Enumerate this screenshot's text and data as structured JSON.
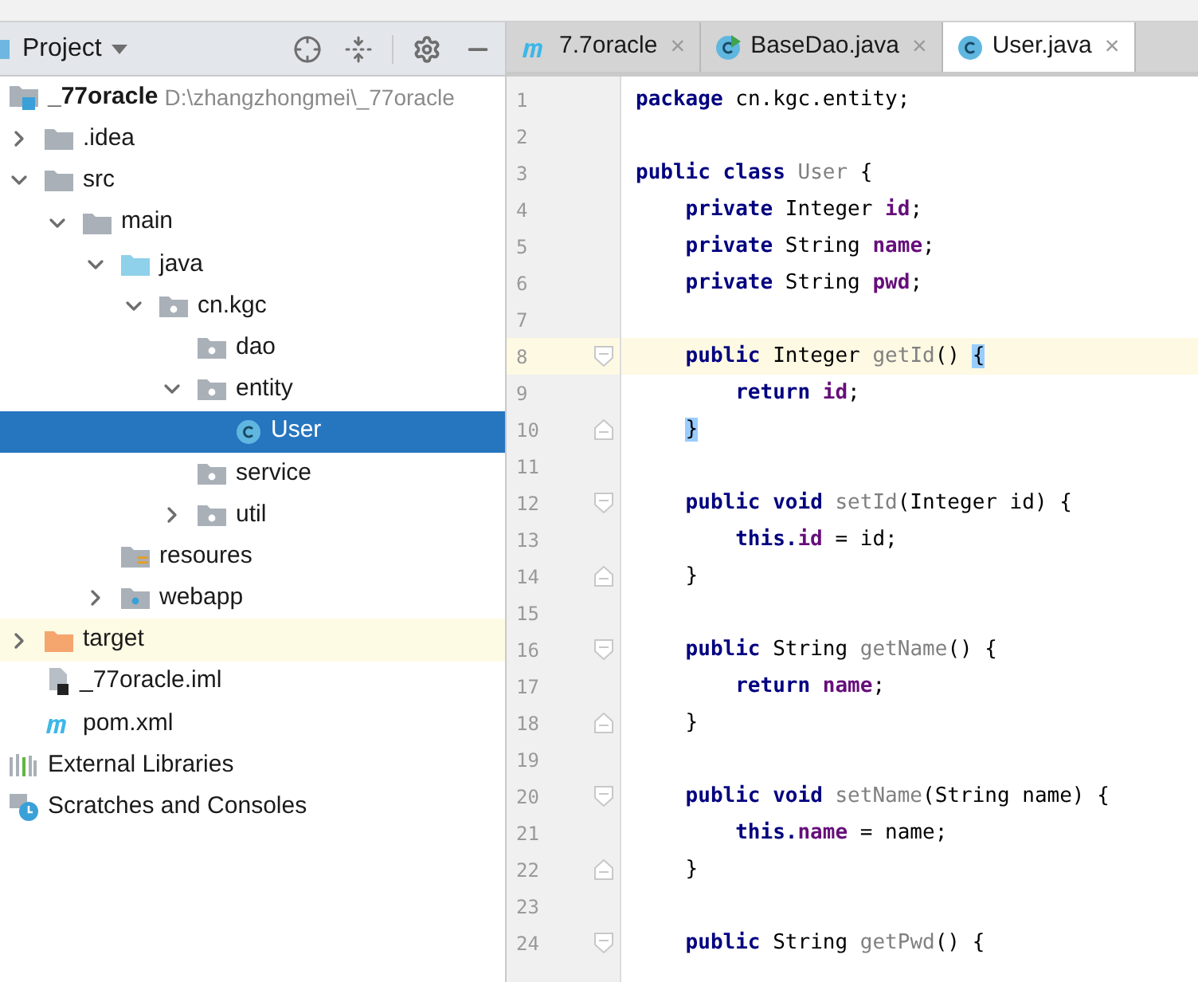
{
  "project_panel": {
    "title": "Project",
    "tree": [
      {
        "kind": "module",
        "name": "_77oracle",
        "path": "D:\\zhangzhongmei\\_77oracle",
        "selected": false,
        "highlighted": false,
        "children": [
          {
            "kind": "folder",
            "name": ".idea",
            "expanded": false,
            "selected": false,
            "highlighted": false
          },
          {
            "kind": "folder",
            "name": "src",
            "expanded": true,
            "selected": false,
            "highlighted": false,
            "children": [
              {
                "kind": "folder",
                "name": "main",
                "expanded": true,
                "selected": false,
                "highlighted": false,
                "children": [
                  {
                    "kind": "source",
                    "name": "java",
                    "expanded": true,
                    "selected": false,
                    "highlighted": false,
                    "children": [
                      {
                        "kind": "package",
                        "name": "cn.kgc",
                        "expanded": true,
                        "selected": false,
                        "highlighted": false,
                        "children": [
                          {
                            "kind": "package",
                            "name": "dao",
                            "selected": false,
                            "highlighted": false
                          },
                          {
                            "kind": "package",
                            "name": "entity",
                            "expanded": true,
                            "selected": false,
                            "highlighted": false,
                            "children": [
                              {
                                "kind": "class",
                                "name": "User",
                                "selected": true,
                                "highlighted": false
                              }
                            ]
                          },
                          {
                            "kind": "package",
                            "name": "service",
                            "selected": false,
                            "highlighted": false
                          },
                          {
                            "kind": "package",
                            "name": "util",
                            "expanded": false,
                            "selected": false,
                            "highlighted": false
                          }
                        ]
                      }
                    ]
                  },
                  {
                    "kind": "resources",
                    "name": "resoures",
                    "selected": false,
                    "highlighted": false
                  },
                  {
                    "kind": "web",
                    "name": "webapp",
                    "expanded": false,
                    "selected": false,
                    "highlighted": false
                  }
                ]
              }
            ]
          },
          {
            "kind": "excluded",
            "name": "target",
            "expanded": false,
            "selected": false,
            "highlighted": true
          },
          {
            "kind": "iml",
            "name": "_77oracle.iml",
            "selected": false,
            "highlighted": false
          },
          {
            "kind": "maven",
            "name": "pom.xml",
            "selected": false,
            "highlighted": false
          }
        ]
      },
      {
        "kind": "libraries",
        "name": "External Libraries",
        "selected": false,
        "highlighted": false
      },
      {
        "kind": "scratches",
        "name": "Scratches and Consoles",
        "selected": false,
        "highlighted": false
      }
    ]
  },
  "tabs": [
    {
      "kind": "maven",
      "label": "7.7oracle",
      "close": "×",
      "selected": false
    },
    {
      "kind": "runnable",
      "label": "BaseDao.java",
      "close": "×",
      "selected": false
    },
    {
      "kind": "class",
      "label": "User.java",
      "close": "×",
      "selected": true
    }
  ],
  "code": [
    {
      "number": "1",
      "kind": "line",
      "current": false,
      "tokens": [
        {
          "kind": "keyword",
          "text": "package"
        },
        {
          "kind": "plain",
          "text": " cn.kgc.entity;"
        }
      ]
    },
    {
      "number": "2",
      "kind": "line",
      "current": false
    },
    {
      "number": "3",
      "kind": "line",
      "current": false,
      "tokens": [
        {
          "kind": "keyword",
          "text": "public class"
        },
        {
          "kind": "unused",
          "text": " User"
        },
        {
          "kind": "plain",
          "text": " {"
        }
      ],
      "children": [
        {
          "number": "4",
          "kind": "line",
          "current": false,
          "tokens": [
            {
              "kind": "keyword",
              "text": "private"
            },
            {
              "kind": "plain",
              "text": " Integer "
            },
            {
              "kind": "field",
              "text": "id"
            },
            {
              "kind": "plain",
              "text": ";"
            }
          ]
        },
        {
          "number": "5",
          "kind": "line",
          "current": false,
          "tokens": [
            {
              "kind": "keyword",
              "text": "private"
            },
            {
              "kind": "plain",
              "text": " String "
            },
            {
              "kind": "field",
              "text": "name"
            },
            {
              "kind": "plain",
              "text": ";"
            }
          ]
        },
        {
          "number": "6",
          "kind": "line",
          "current": false,
          "tokens": [
            {
              "kind": "keyword",
              "text": "private"
            },
            {
              "kind": "plain",
              "text": " String "
            },
            {
              "kind": "field",
              "text": "pwd"
            },
            {
              "kind": "plain",
              "text": ";"
            }
          ]
        },
        {
          "number": "7",
          "kind": "line",
          "current": false
        },
        {
          "number": "8",
          "kind": "opener",
          "current": true,
          "tokens": [
            {
              "kind": "keyword",
              "text": "public"
            },
            {
              "kind": "plain",
              "text": " Integer "
            },
            {
              "kind": "unused",
              "text": "getId"
            },
            {
              "kind": "plain",
              "text": "() "
            },
            {
              "kind": "match",
              "text": "{"
            }
          ],
          "children": [
            {
              "number": "9",
              "kind": "line",
              "current": false,
              "tokens": [
                {
                  "kind": "keyword",
                  "text": "return"
                },
                {
                  "kind": "field",
                  "text": " id"
                },
                {
                  "kind": "plain",
                  "text": ";"
                }
              ]
            }
          ]
        },
        {
          "number": "10",
          "kind": "closer",
          "current": false,
          "tokens": [
            {
              "kind": "match",
              "text": "}"
            }
          ]
        },
        {
          "number": "11",
          "kind": "line",
          "current": false
        },
        {
          "number": "12",
          "kind": "opener",
          "current": false,
          "tokens": [
            {
              "kind": "keyword",
              "text": "public void"
            },
            {
              "kind": "unused",
              "text": " setId"
            },
            {
              "kind": "plain",
              "text": "(Integer id) {"
            }
          ],
          "children": [
            {
              "number": "13",
              "kind": "line",
              "current": false,
              "tokens": [
                {
                  "kind": "keyword",
                  "text": "this."
                },
                {
                  "kind": "field",
                  "text": "id"
                },
                {
                  "kind": "plain",
                  "text": " = id;"
                }
              ]
            }
          ]
        },
        {
          "number": "14",
          "kind": "closer",
          "current": false,
          "tokens": [
            {
              "kind": "plain",
              "text": "}"
            }
          ]
        },
        {
          "number": "15",
          "kind": "line",
          "current": false
        },
        {
          "number": "16",
          "kind": "opener",
          "current": false,
          "tokens": [
            {
              "kind": "keyword",
              "text": "public"
            },
            {
              "kind": "plain",
              "text": " String "
            },
            {
              "kind": "unused",
              "text": "getName"
            },
            {
              "kind": "plain",
              "text": "() {"
            }
          ],
          "children": [
            {
              "number": "17",
              "kind": "line",
              "current": false,
              "tokens": [
                {
                  "kind": "keyword",
                  "text": "return"
                },
                {
                  "kind": "field",
                  "text": " name"
                },
                {
                  "kind": "plain",
                  "text": ";"
                }
              ]
            }
          ]
        },
        {
          "number": "18",
          "kind": "closer",
          "current": false,
          "tokens": [
            {
              "kind": "plain",
              "text": "}"
            }
          ]
        },
        {
          "number": "19",
          "kind": "line",
          "current": false
        },
        {
          "number": "20",
          "kind": "opener",
          "current": false,
          "tokens": [
            {
              "kind": "keyword",
              "text": "public void"
            },
            {
              "kind": "unused",
              "text": " setName"
            },
            {
              "kind": "plain",
              "text": "(String name) {"
            }
          ],
          "children": [
            {
              "number": "21",
              "kind": "line",
              "current": false,
              "tokens": [
                {
                  "kind": "keyword",
                  "text": "this."
                },
                {
                  "kind": "field",
                  "text": "name"
                },
                {
                  "kind": "plain",
                  "text": " = name;"
                }
              ]
            }
          ]
        },
        {
          "number": "22",
          "kind": "closer",
          "current": false,
          "tokens": [
            {
              "kind": "plain",
              "text": "}"
            }
          ]
        },
        {
          "number": "23",
          "kind": "line",
          "current": false
        },
        {
          "number": "24",
          "kind": "opener",
          "current": false,
          "tokens": [
            {
              "kind": "keyword",
              "text": "public"
            },
            {
              "kind": "plain",
              "text": " String "
            },
            {
              "kind": "unused",
              "text": "getPwd"
            },
            {
              "kind": "plain",
              "text": "() {"
            }
          ]
        }
      ]
    }
  ]
}
